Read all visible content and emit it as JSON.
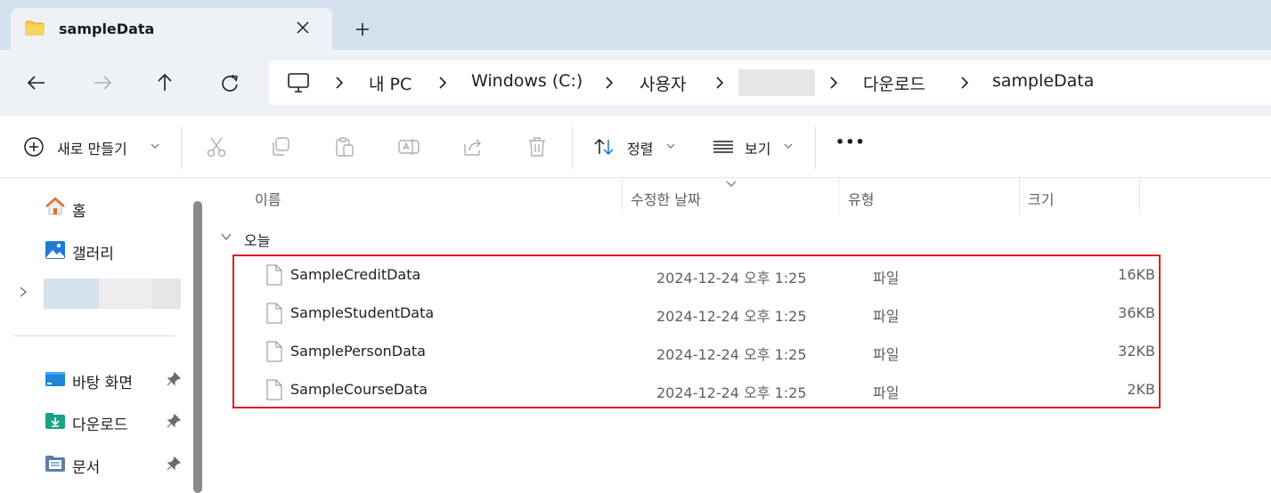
{
  "window": {
    "tab_title": "sampleData"
  },
  "address_bar": {
    "segments": [
      "내 PC",
      "Windows (C:)",
      "사용자",
      "다운로드",
      "sampleData"
    ]
  },
  "command_bar": {
    "new_label": "새로 만들기",
    "sort_label": "정렬",
    "view_label": "보기",
    "more_label": "•••"
  },
  "sidebar": {
    "items": [
      {
        "label": "홈",
        "icon": "home-icon"
      },
      {
        "label": "갤러리",
        "icon": "gallery-icon"
      },
      {
        "label": "바탕 화면",
        "icon": "desktop-icon",
        "pinned": true
      },
      {
        "label": "다운로드",
        "icon": "downloads-icon",
        "pinned": true
      },
      {
        "label": "문서",
        "icon": "documents-icon",
        "pinned": true
      }
    ]
  },
  "file_list": {
    "columns": [
      "이름",
      "수정한 날짜",
      "유형",
      "크기"
    ],
    "group_label": "오늘",
    "rows": [
      {
        "name": "SampleCreditData",
        "modified": "2024-12-24 오후 1:25",
        "type": "파일",
        "size": "16KB"
      },
      {
        "name": "SampleStudentData",
        "modified": "2024-12-24 오후 1:25",
        "type": "파일",
        "size": "36KB"
      },
      {
        "name": "SamplePersonData",
        "modified": "2024-12-24 오후 1:25",
        "type": "파일",
        "size": "32KB"
      },
      {
        "name": "SampleCourseData",
        "modified": "2024-12-24 오후 1:25",
        "type": "파일",
        "size": "2KB"
      }
    ]
  },
  "colors": {
    "tabstrip": "#d3e1ee",
    "navbar": "#eef2f7",
    "highlight_border": "#e01b24",
    "folder": "#f8c84a"
  }
}
